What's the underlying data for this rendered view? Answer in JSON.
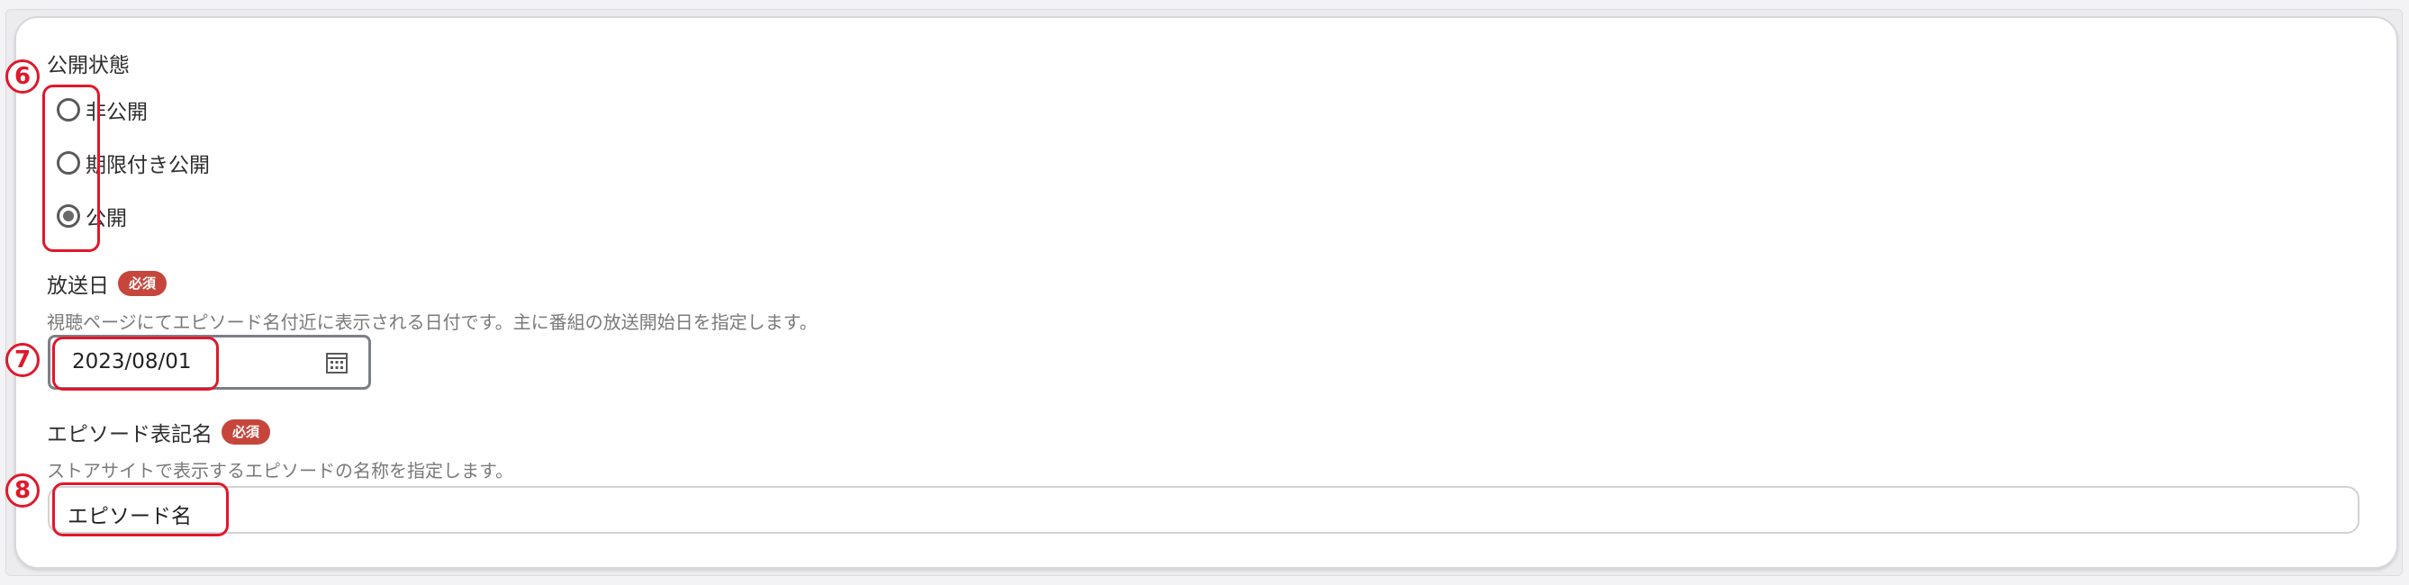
{
  "visibility": {
    "label": "公開状態",
    "options": [
      {
        "label": "非公開",
        "selected": false
      },
      {
        "label": "期限付き公開",
        "selected": false
      },
      {
        "label": "公開",
        "selected": true
      }
    ]
  },
  "broadcast_date": {
    "label": "放送日",
    "required_badge": "必須",
    "helper": "視聴ページにてエピソード名付近に表示される日付です。主に番組の放送開始日を指定します。",
    "value": "2023/08/01",
    "icon": "calendar-icon"
  },
  "episode_name": {
    "label": "エピソード表記名",
    "required_badge": "必須",
    "helper": "ストアサイトで表示するエピソードの名称を指定します。",
    "value": "エピソード名"
  },
  "annotations": {
    "marker_6": "6",
    "marker_7": "7",
    "marker_8": "8"
  },
  "colors": {
    "accent_red": "#e0182a",
    "badge_red": "#c6463c",
    "card_border": "#d7d7dc"
  }
}
